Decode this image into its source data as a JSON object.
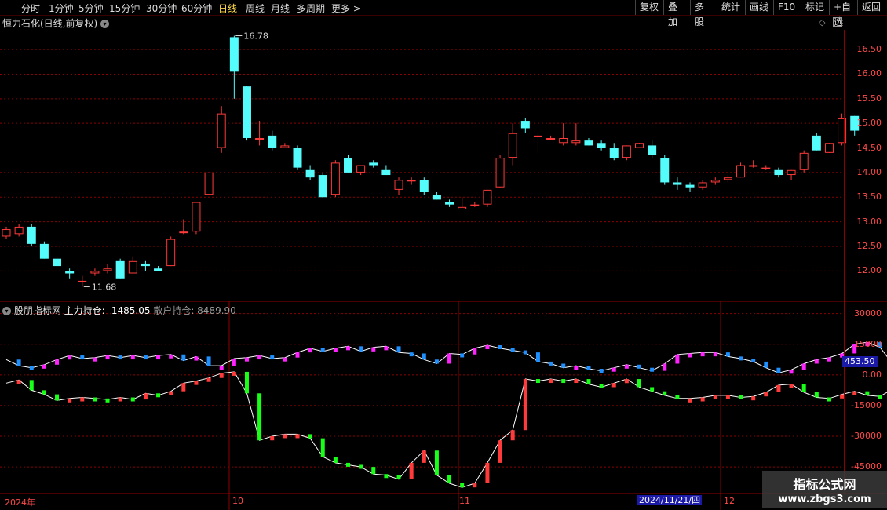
{
  "toolbar": {
    "periods": [
      {
        "label": "分时",
        "active": false
      },
      {
        "label": "1分钟",
        "active": false
      },
      {
        "label": "5分钟",
        "active": false
      },
      {
        "label": "15分钟",
        "active": false
      },
      {
        "label": "30分钟",
        "active": false
      },
      {
        "label": "60分钟",
        "active": false
      },
      {
        "label": "日线",
        "active": true
      },
      {
        "label": "周线",
        "active": false
      },
      {
        "label": "月线",
        "active": false
      },
      {
        "label": "多周期",
        "active": false
      },
      {
        "label": "更多 >",
        "active": false
      }
    ],
    "actions": [
      "复权",
      "叠加",
      "多股",
      "统计",
      "画线",
      "F10",
      "标记",
      "+自选",
      "返回"
    ]
  },
  "main_chart": {
    "title": "恒力石化(日线,前复权)",
    "high_label": "16.78",
    "low_label": "11.68",
    "y_ticks": [
      "16.50",
      "16.00",
      "15.50",
      "15.00",
      "14.50",
      "14.00",
      "13.50",
      "13.00",
      "12.50",
      "12.00"
    ]
  },
  "indicator": {
    "source_name": "股朋指标网",
    "main_label": "主力持仓: -1485.05",
    "retail_label": "散户持仓: 8489.90",
    "y_ticks": [
      "30000",
      "15000",
      "0.00",
      "-15000",
      "-30000",
      "-45000"
    ],
    "current_value": "453.50"
  },
  "x_axis": {
    "labels": [
      "2024年",
      "10",
      "11",
      "12"
    ],
    "cursor_date": "2024/11/21/四"
  },
  "watermark": {
    "title": "指标公式网",
    "url": "www.zbgs3.com"
  },
  "colors": {
    "up": "#ff3a3a",
    "down": "#54fcfc",
    "magenta": "#ff22ff",
    "blue": "#1e90ff",
    "green": "#18ff18",
    "grid": "#8b0000",
    "axis_text": "#ff4a4a",
    "active_period": "#ffd84a"
  },
  "chart_data": [
    {
      "type": "candlestick",
      "title": "恒力石化(日线,前复权)",
      "ylim": [
        11.4,
        16.9
      ],
      "fields": [
        "open",
        "high",
        "low",
        "close"
      ],
      "candles": [
        [
          12.7,
          12.9,
          12.65,
          12.85
        ],
        [
          12.75,
          12.95,
          12.7,
          12.9
        ],
        [
          12.9,
          12.95,
          12.5,
          12.55
        ],
        [
          12.55,
          12.6,
          12.25,
          12.25
        ],
        [
          12.25,
          12.3,
          12.1,
          12.1
        ],
        [
          12.0,
          12.05,
          11.85,
          11.95
        ],
        [
          11.8,
          11.9,
          11.68,
          11.8
        ],
        [
          11.95,
          12.05,
          11.9,
          12.0
        ],
        [
          12.0,
          12.15,
          11.95,
          12.05
        ],
        [
          12.2,
          12.25,
          11.85,
          11.85
        ],
        [
          11.95,
          12.3,
          11.95,
          12.2
        ],
        [
          12.15,
          12.2,
          12.0,
          12.1
        ],
        [
          12.05,
          12.1,
          12.0,
          12.0
        ],
        [
          12.1,
          12.7,
          12.1,
          12.65
        ],
        [
          12.8,
          13.05,
          12.75,
          12.8
        ],
        [
          12.8,
          13.4,
          12.75,
          13.4
        ],
        [
          13.55,
          14.0,
          13.55,
          14.0
        ],
        [
          14.5,
          15.35,
          14.4,
          15.2
        ],
        [
          16.75,
          16.78,
          15.5,
          16.05
        ],
        [
          15.75,
          15.75,
          14.65,
          14.7
        ],
        [
          14.7,
          15.05,
          14.55,
          14.7
        ],
        [
          14.75,
          14.85,
          14.45,
          14.5
        ],
        [
          14.5,
          14.6,
          14.5,
          14.55
        ],
        [
          14.5,
          14.55,
          14.05,
          14.1
        ],
        [
          14.05,
          14.15,
          13.85,
          13.9
        ],
        [
          13.95,
          14.0,
          13.5,
          13.5
        ],
        [
          13.55,
          14.25,
          13.5,
          14.2
        ],
        [
          14.3,
          14.35,
          14.0,
          14.0
        ],
        [
          14.0,
          14.15,
          13.95,
          14.15
        ],
        [
          14.2,
          14.25,
          14.1,
          14.15
        ],
        [
          14.05,
          14.15,
          13.95,
          13.95
        ],
        [
          13.65,
          13.9,
          13.55,
          13.85
        ],
        [
          13.85,
          13.9,
          13.75,
          13.85
        ],
        [
          13.85,
          13.9,
          13.55,
          13.6
        ],
        [
          13.55,
          13.6,
          13.45,
          13.45
        ],
        [
          13.4,
          13.45,
          13.3,
          13.35
        ],
        [
          13.25,
          13.5,
          13.25,
          13.3
        ],
        [
          13.35,
          13.4,
          13.3,
          13.35
        ],
        [
          13.35,
          13.65,
          13.3,
          13.65
        ],
        [
          13.7,
          14.35,
          13.7,
          14.3
        ],
        [
          14.3,
          15.0,
          14.15,
          14.8
        ],
        [
          15.05,
          15.1,
          14.8,
          14.9
        ],
        [
          14.75,
          14.8,
          14.4,
          14.75
        ],
        [
          14.7,
          14.75,
          14.7,
          14.7
        ],
        [
          14.6,
          15.0,
          14.55,
          14.7
        ],
        [
          14.6,
          15.0,
          14.55,
          14.65
        ],
        [
          14.65,
          14.7,
          14.55,
          14.55
        ],
        [
          14.6,
          14.65,
          14.45,
          14.5
        ],
        [
          14.5,
          14.6,
          14.25,
          14.3
        ],
        [
          14.3,
          14.55,
          14.25,
          14.55
        ],
        [
          14.5,
          14.6,
          14.5,
          14.6
        ],
        [
          14.55,
          14.65,
          14.3,
          14.35
        ],
        [
          14.3,
          14.35,
          13.75,
          13.8
        ],
        [
          13.8,
          13.9,
          13.65,
          13.75
        ],
        [
          13.75,
          13.8,
          13.6,
          13.7
        ],
        [
          13.7,
          13.85,
          13.65,
          13.8
        ],
        [
          13.8,
          13.9,
          13.75,
          13.85
        ],
        [
          13.85,
          13.95,
          13.8,
          13.9
        ],
        [
          13.9,
          14.2,
          13.9,
          14.15
        ],
        [
          14.15,
          14.25,
          14.1,
          14.15
        ],
        [
          14.1,
          14.15,
          14.05,
          14.1
        ],
        [
          14.05,
          14.1,
          13.9,
          13.95
        ],
        [
          13.95,
          14.05,
          13.85,
          14.05
        ],
        [
          14.05,
          14.45,
          14.0,
          14.4
        ],
        [
          14.75,
          14.8,
          14.45,
          14.45
        ],
        [
          14.4,
          14.6,
          14.4,
          14.6
        ],
        [
          14.6,
          15.2,
          14.55,
          15.1
        ],
        [
          15.15,
          15.15,
          14.75,
          14.85
        ]
      ]
    },
    {
      "type": "line",
      "title": "股朋指标网",
      "ylim": [
        -58000,
        36000
      ],
      "series": [
        {
          "name": "主力持仓",
          "values": [
            -4000,
            -2500,
            -7500,
            -9500,
            -12500,
            -11500,
            -11000,
            -11500,
            -12000,
            -11000,
            -12000,
            -9000,
            -10000,
            -8000,
            -4000,
            -3000,
            -1500,
            800,
            1500,
            -9000,
            -32000,
            -30000,
            -29000,
            -29000,
            -31000,
            -40000,
            -43000,
            -44000,
            -45000,
            -48500,
            -49000,
            -51000,
            -43000,
            -37000,
            -49000,
            -53000,
            -55000,
            -53000,
            -43000,
            -32000,
            -27000,
            -2000,
            -3000,
            -2000,
            -3000,
            -2000,
            -4500,
            -6000,
            -4000,
            -2000,
            -6000,
            -8000,
            -10000,
            -11500,
            -11500,
            -11000,
            -10000,
            -10000,
            -11000,
            -10500,
            -8500,
            -5000,
            -4500,
            -8500,
            -11000,
            -11500,
            -9500,
            -8000,
            -10000,
            -10500,
            -7000,
            200,
            5500
          ]
        },
        {
          "name": "散户持仓",
          "values": [
            7500,
            4500,
            3500,
            5000,
            7500,
            9500,
            8000,
            8500,
            9500,
            8500,
            9500,
            8500,
            9500,
            10000,
            7000,
            9000,
            4500,
            4500,
            8000,
            8500,
            9500,
            8000,
            8500,
            11000,
            13000,
            11500,
            13000,
            14000,
            11500,
            13500,
            14000,
            11000,
            10500,
            7500,
            5500,
            10500,
            10000,
            13000,
            14500,
            13000,
            12000,
            11000,
            6500,
            5500,
            3500,
            4500,
            3000,
            2000,
            3500,
            5000,
            3500,
            2000,
            5500,
            10000,
            10500,
            11000,
            11000,
            9000,
            8000,
            6500,
            3500,
            1000,
            2500,
            5500,
            7500,
            8500,
            10500,
            15000,
            16000,
            13500,
            5500,
            11000,
            13000
          ]
        }
      ]
    }
  ]
}
